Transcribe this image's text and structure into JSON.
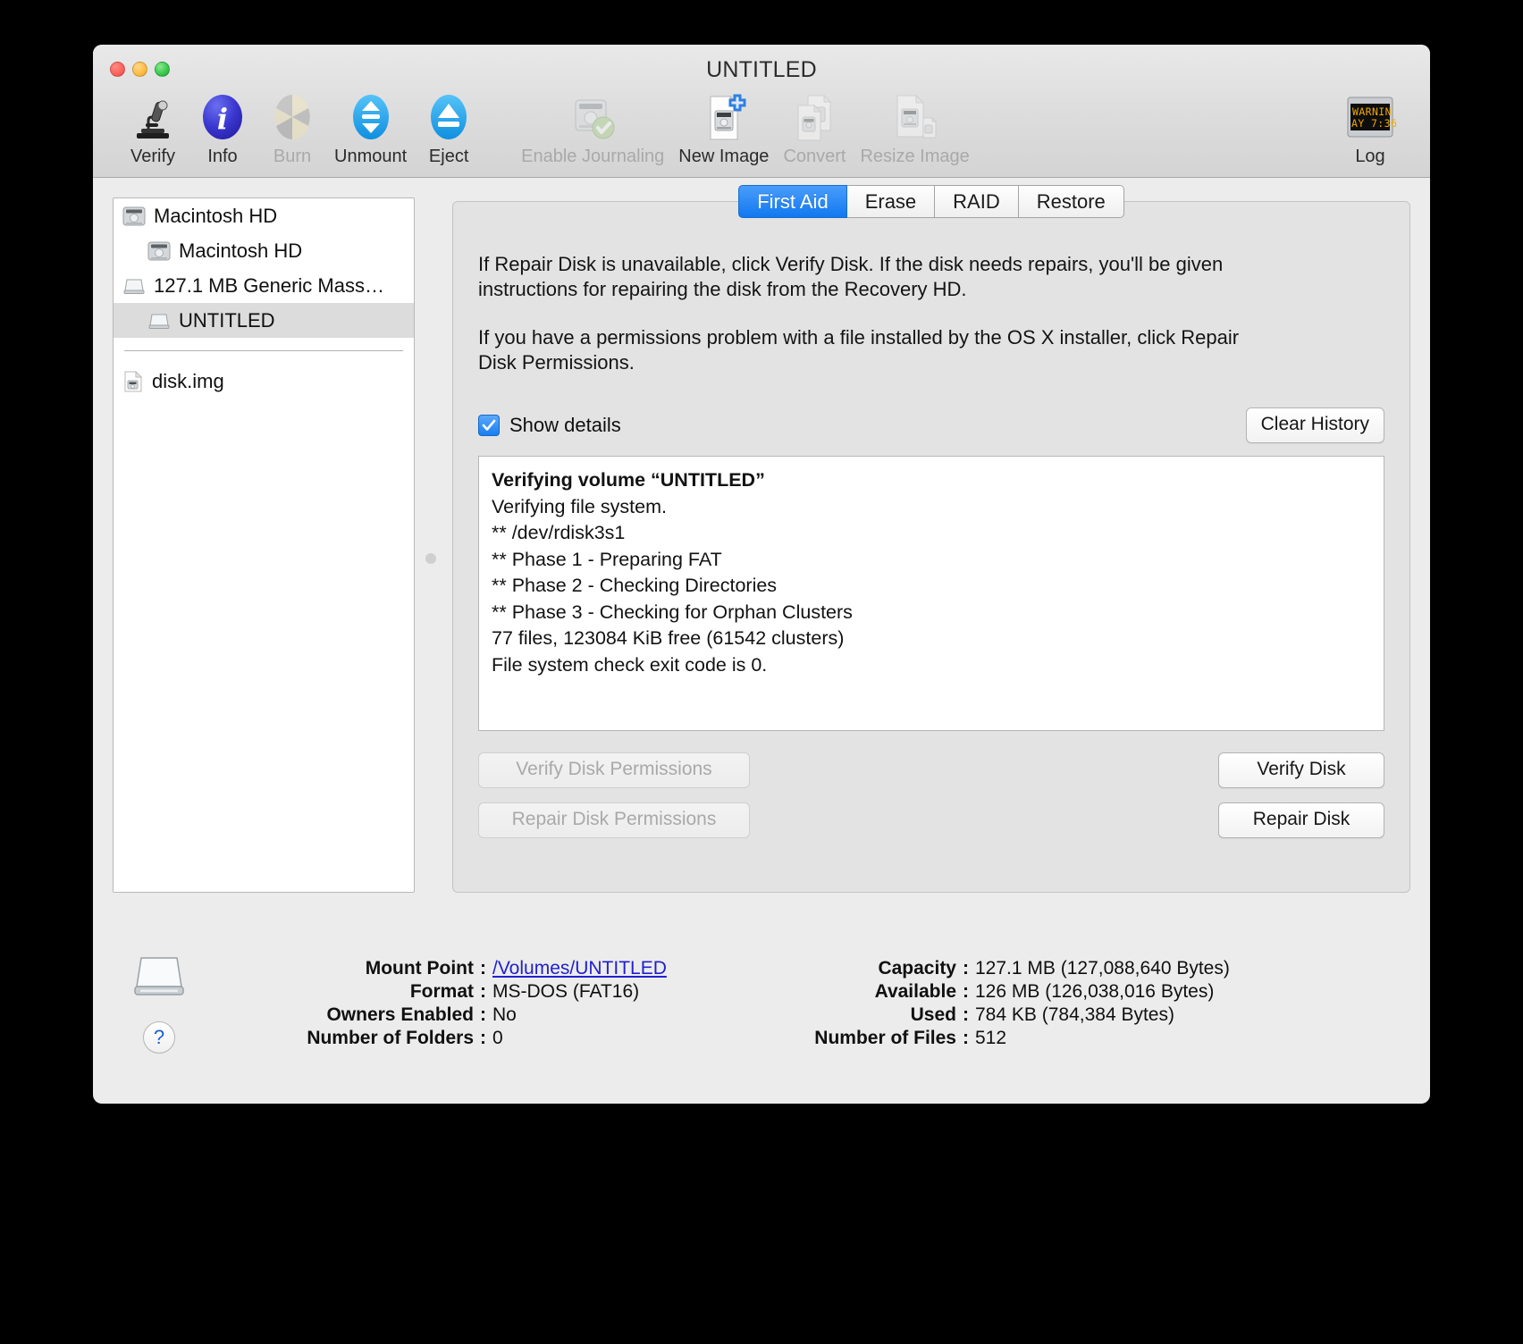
{
  "window": {
    "title": "UNTITLED"
  },
  "toolbar": {
    "items": [
      {
        "label": "Verify",
        "icon": "microscope-icon",
        "disabled": false
      },
      {
        "label": "Info",
        "icon": "info-icon",
        "disabled": false
      },
      {
        "label": "Burn",
        "icon": "burn-icon",
        "disabled": true
      },
      {
        "label": "Unmount",
        "icon": "unmount-icon",
        "disabled": false
      },
      {
        "label": "Eject",
        "icon": "eject-icon",
        "disabled": false
      },
      {
        "label": "Enable Journaling",
        "icon": "journaling-disk-icon",
        "disabled": true
      },
      {
        "label": "New Image",
        "icon": "new-image-icon",
        "disabled": false
      },
      {
        "label": "Convert",
        "icon": "convert-icon",
        "disabled": true
      },
      {
        "label": "Resize Image",
        "icon": "resize-image-icon",
        "disabled": true
      }
    ],
    "log": {
      "label": "Log",
      "icon": "log-icon",
      "screen_line1": "WARNIN",
      "screen_line2": "AY 7:36"
    }
  },
  "sidebar": {
    "items": [
      {
        "label": "Macintosh HD",
        "icon": "hard-drive-icon",
        "indent": false,
        "selected": false
      },
      {
        "label": "Macintosh HD",
        "icon": "hard-drive-icon",
        "indent": true,
        "selected": false
      },
      {
        "label": "127.1 MB Generic Mass…",
        "icon": "removable-disk-icon",
        "indent": false,
        "selected": false
      },
      {
        "label": "UNTITLED",
        "icon": "removable-disk-icon",
        "indent": true,
        "selected": true
      }
    ],
    "images": [
      {
        "label": "disk.img",
        "icon": "disk-image-icon",
        "selected": false
      }
    ]
  },
  "tabs": [
    {
      "label": "First Aid",
      "active": true
    },
    {
      "label": "Erase",
      "active": false
    },
    {
      "label": "RAID",
      "active": false
    },
    {
      "label": "Restore",
      "active": false
    }
  ],
  "first_aid": {
    "paragraph1": "If Repair Disk is unavailable, click Verify Disk. If the disk needs repairs, you'll be given instructions for repairing the disk from the Recovery HD.",
    "paragraph2": "If you have a permissions problem with a file installed by the OS X installer, click Repair Disk Permissions.",
    "show_details_label": "Show details",
    "show_details_checked": true,
    "clear_history_label": "Clear History",
    "log_lines": [
      {
        "text": "Verifying volume “UNTITLED”",
        "bold": true
      },
      {
        "text": "Verifying file system.",
        "bold": false
      },
      {
        "text": "** /dev/rdisk3s1",
        "bold": false
      },
      {
        "text": "** Phase 1 - Preparing FAT",
        "bold": false
      },
      {
        "text": "** Phase 2 - Checking Directories",
        "bold": false
      },
      {
        "text": "** Phase 3 - Checking for Orphan Clusters",
        "bold": false
      },
      {
        "text": "77 files, 123084 KiB free (61542 clusters)",
        "bold": false
      },
      {
        "text": "File system check exit code is 0.",
        "bold": false
      }
    ],
    "buttons": [
      {
        "label": "Verify Disk Permissions",
        "disabled": true
      },
      {
        "label": "Verify Disk",
        "disabled": false
      },
      {
        "label": "Repair Disk Permissions",
        "disabled": true
      },
      {
        "label": "Repair Disk",
        "disabled": false
      }
    ]
  },
  "info": {
    "left": [
      {
        "key": "Mount Point",
        "value": "/Volumes/UNTITLED",
        "link": true
      },
      {
        "key": "Format",
        "value": "MS-DOS (FAT16)",
        "link": false
      },
      {
        "key": "Owners Enabled",
        "value": "No",
        "link": false
      },
      {
        "key": "Number of Folders",
        "value": "0",
        "link": false
      }
    ],
    "right": [
      {
        "key": "Capacity",
        "value": "127.1 MB (127,088,640 Bytes)"
      },
      {
        "key": "Available",
        "value": "126 MB (126,038,016 Bytes)"
      },
      {
        "key": "Used",
        "value": "784 KB (784,384 Bytes)"
      },
      {
        "key": "Number of Files",
        "value": "512"
      }
    ],
    "help_label": "?",
    "volume_icon": "removable-disk-icon"
  },
  "colors": {
    "accent": "#1178f0",
    "link": "#2020d0",
    "window_bg": "#ececec",
    "panel_bg": "#e3e3e3"
  }
}
